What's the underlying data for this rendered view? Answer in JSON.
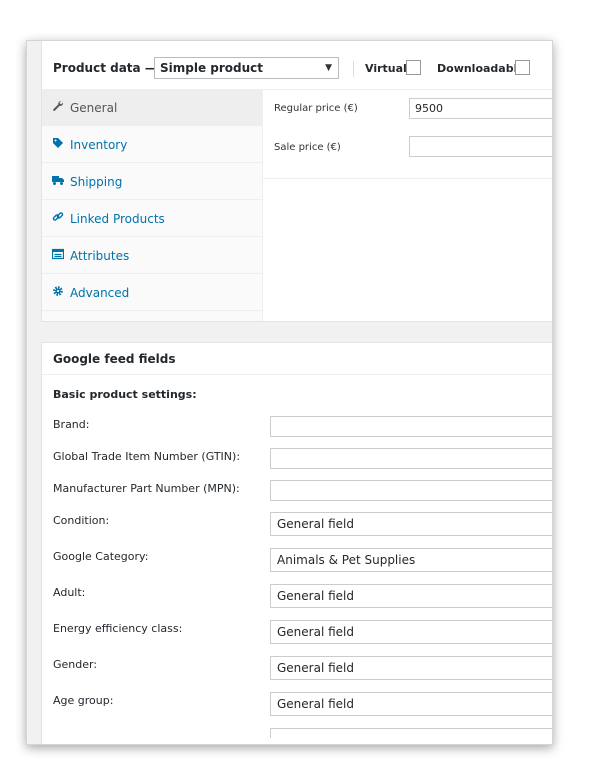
{
  "product_data": {
    "title": "Product data —",
    "product_type": "Simple product",
    "virtual_label": "Virtual:",
    "downloadable_label": "Downloadable:",
    "virtual_checked": false,
    "downloadable_checked": false
  },
  "tabs": [
    {
      "label": "General",
      "icon": "wrench-icon",
      "active": true
    },
    {
      "label": "Inventory",
      "icon": "tag-icon",
      "active": false
    },
    {
      "label": "Shipping",
      "icon": "truck-icon",
      "active": false
    },
    {
      "label": "Linked Products",
      "icon": "link-icon",
      "active": false
    },
    {
      "label": "Attributes",
      "icon": "table-icon",
      "active": false
    },
    {
      "label": "Advanced",
      "icon": "gear-icon",
      "active": false
    }
  ],
  "general": {
    "regular_price_label": "Regular price (€)",
    "regular_price_value": "9500",
    "sale_price_label": "Sale price (€)",
    "sale_price_value": ""
  },
  "google_feed": {
    "title": "Google feed fields",
    "section_heading": "Basic product settings:",
    "fields": [
      {
        "label": "Brand:",
        "value": ""
      },
      {
        "label": "Global Trade Item Number (GTIN):",
        "value": ""
      },
      {
        "label": "Manufacturer Part Number (MPN):",
        "value": ""
      },
      {
        "label": "Condition:",
        "value": "General field"
      },
      {
        "label": "Google Category:",
        "value": "Animals & Pet Supplies"
      },
      {
        "label": "Adult:",
        "value": "General field"
      },
      {
        "label": "Energy efficiency class:",
        "value": "General field"
      },
      {
        "label": "Gender:",
        "value": "General field"
      },
      {
        "label": "Age group:",
        "value": "General field"
      }
    ]
  },
  "colors": {
    "link": "#0073aa",
    "active_tab_bg": "#eeeeee",
    "panel_bg": "#f1f1f1"
  }
}
